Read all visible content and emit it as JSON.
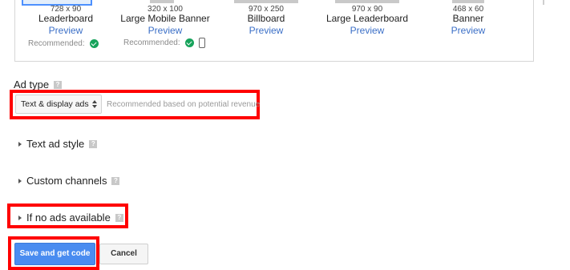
{
  "ad_sizes": [
    {
      "dims": "728 x 90",
      "name": "Leaderboard",
      "preview": "Preview",
      "recommended": "Recommended:",
      "selected": true,
      "check_icon": "check-circle-icon",
      "device_icon": ""
    },
    {
      "dims": "320 x 100",
      "name": "Large Mobile Banner",
      "preview": "Preview",
      "recommended": "Recommended:",
      "selected": false,
      "check_icon": "check-circle-icon",
      "device_icon": "mobile-phone-icon"
    },
    {
      "dims": "970 x 250",
      "name": "Billboard",
      "preview": "Preview",
      "recommended": "",
      "selected": false
    },
    {
      "dims": "970 x 90",
      "name": "Large Leaderboard",
      "preview": "Preview",
      "recommended": "",
      "selected": false
    },
    {
      "dims": "468 x 60",
      "name": "Banner",
      "preview": "Preview",
      "recommended": "",
      "selected": false
    }
  ],
  "ad_type": {
    "label": "Ad type",
    "help_icon": "?",
    "selected_value": "Text & display ads",
    "recommendation_note": "Recommended based on potential revenue"
  },
  "sections": {
    "text_ad_style": "Text ad style",
    "custom_channels": "Custom channels",
    "if_no_ads": "If no ads available",
    "help_icon": "?"
  },
  "buttons": {
    "save": "Save and get code",
    "cancel": "Cancel"
  },
  "colors": {
    "highlight_red": "#ff0000",
    "link_blue": "#3b6fc7",
    "primary_button": "#4a8cf0",
    "check_green": "#17a35b"
  }
}
